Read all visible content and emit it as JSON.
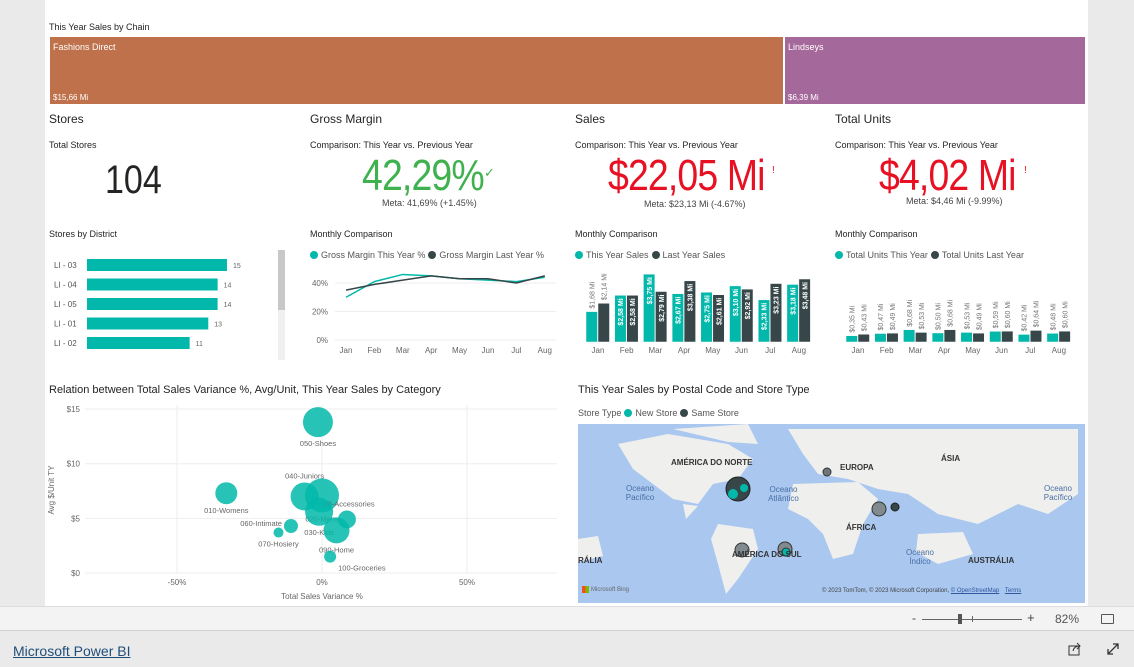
{
  "treemap": {
    "title": "This Year Sales by Chain",
    "items": [
      {
        "label": "Fashions Direct",
        "value": "$15,66 Mi",
        "color": "#be714b"
      },
      {
        "label": "Lindseys",
        "value": "$6,39 Mi",
        "color": "#a5689a"
      }
    ]
  },
  "kpis": {
    "stores": {
      "title": "Stores",
      "subtitle": "Total Stores",
      "value": "104"
    },
    "gross_margin": {
      "title": "Gross Margin",
      "subtitle": "Comparison: This Year vs. Previous Year",
      "value": "42,29%",
      "status_icon": "check-icon",
      "goal": "Meta: 41,69% (+1.45%)",
      "color": "#3fb14e"
    },
    "sales": {
      "title": "Sales",
      "subtitle": "Comparison: This Year vs. Previous Year",
      "value": "$22,05 Mi",
      "status_icon": "!",
      "goal": "Meta: $23,13 Mi (-4.67%)",
      "color": "#e81123"
    },
    "units": {
      "title": "Total Units",
      "subtitle": "Comparison: This Year vs. Previous Year",
      "value": "$4,02 Mi",
      "status_icon": "!",
      "goal": "Meta: $4,46 Mi (-9.99%)",
      "color": "#e81123"
    }
  },
  "colors": {
    "teal": "#01b8aa",
    "dark": "#374649"
  },
  "chart_data": [
    {
      "type": "bar",
      "orientation": "horizontal",
      "title": "Stores by District",
      "categories": [
        "LI - 03",
        "LI - 04",
        "LI - 05",
        "LI - 01",
        "LI - 02"
      ],
      "values": [
        15,
        14,
        14,
        13,
        11
      ]
    },
    {
      "type": "line",
      "title": "Monthly Comparison",
      "categories": [
        "Jan",
        "Feb",
        "Mar",
        "Apr",
        "May",
        "Jun",
        "Jul",
        "Aug"
      ],
      "yticks": [
        "0%",
        "20%",
        "40%"
      ],
      "ylim": [
        0,
        55
      ],
      "series": [
        {
          "name": "Gross Margin This Year %",
          "values": [
            30,
            41,
            46,
            45,
            43,
            42,
            41,
            44
          ]
        },
        {
          "name": "Gross Margin Last Year %",
          "values": [
            35,
            39,
            42,
            45,
            43,
            43,
            40,
            45
          ]
        }
      ]
    },
    {
      "type": "bar",
      "title": "Monthly Comparison",
      "categories": [
        "Jan",
        "Feb",
        "Mar",
        "Apr",
        "May",
        "Jun",
        "Jul",
        "Aug"
      ],
      "ylim": [
        0,
        4
      ],
      "series": [
        {
          "name": "This Year Sales",
          "values": [
            1.68,
            2.58,
            3.75,
            2.67,
            2.75,
            3.1,
            2.33,
            3.18
          ],
          "labels": [
            "$1,68 Mi",
            "$2,58 Mi",
            "$3,75 Mi",
            "$2,67 Mi",
            "$2,75 Mi",
            "$3,10 Mi",
            "$2,33 Mi",
            "$3,18 Mi"
          ]
        },
        {
          "name": "Last Year Sales",
          "values": [
            2.14,
            2.58,
            2.79,
            3.38,
            2.61,
            2.92,
            3.23,
            3.48
          ],
          "labels": [
            "$2,14 Mi",
            "$2,58 Mi",
            "$2,79 Mi",
            "$3,38 Mi",
            "$2,61 Mi",
            "$2,92 Mi",
            "$3,23 Mi",
            "$3,48 Mi"
          ]
        }
      ]
    },
    {
      "type": "bar",
      "title": "Monthly Comparison",
      "categories": [
        "Jan",
        "Feb",
        "Mar",
        "Apr",
        "May",
        "Jun",
        "Jul",
        "Aug"
      ],
      "ylim": [
        0,
        4
      ],
      "series": [
        {
          "name": "Total Units This Year",
          "values": [
            0.35,
            0.47,
            0.68,
            0.5,
            0.53,
            0.59,
            0.42,
            0.48
          ],
          "labels": [
            "$0,35 Mi",
            "$0,47 Mi",
            "$0,68 Mi",
            "$0,50 Mi",
            "$0,53 Mi",
            "$0,59 Mi",
            "$0,42 Mi",
            "$0,48 Mi"
          ]
        },
        {
          "name": "Total Units Last Year",
          "values": [
            0.43,
            0.49,
            0.53,
            0.68,
            0.49,
            0.6,
            0.64,
            0.6
          ],
          "labels": [
            "$0,43 Mi",
            "$0,49 Mi",
            "$0,53 Mi",
            "$0,68 Mi",
            "$0,49 Mi",
            "$0,60 Mi",
            "$0,64 Mi",
            "$0,60 Mi"
          ]
        }
      ]
    },
    {
      "type": "scatter",
      "title": "Relation between Total Sales Variance %, Avg/Unit, This Year Sales by Category",
      "xlabel": "Total Sales Variance %",
      "ylabel": "Avg $/Unit TY",
      "xticks": [
        "-50%",
        "0%",
        "50%"
      ],
      "yticks": [
        "$0",
        "$5",
        "$10",
        "$15"
      ],
      "xlim": [
        -82,
        81
      ],
      "ylim": [
        0,
        15
      ],
      "points": [
        {
          "label": "050-Shoes",
          "x": -1.4,
          "y": 13.8,
          "size": 15
        },
        {
          "label": "010-Womens",
          "x": -33,
          "y": 7.3,
          "size": 11
        },
        {
          "label": "040-Juniors",
          "x": -6,
          "y": 7.0,
          "size": 14
        },
        {
          "label": "020-Mens",
          "x": 0,
          "y": 7.1,
          "size": 17
        },
        {
          "label": "080-Accessories",
          "x": 8.6,
          "y": 4.9,
          "size": 9
        },
        {
          "label": "030-Kids",
          "x": -1,
          "y": 5.6,
          "size": 14
        },
        {
          "label": "060-Intimate",
          "x": -10.7,
          "y": 4.3,
          "size": 7
        },
        {
          "label": "070-Hosiery",
          "x": -15,
          "y": 3.7,
          "size": 5
        },
        {
          "label": "090-Home",
          "x": 5,
          "y": 3.9,
          "size": 13
        },
        {
          "label": "100-Groceries",
          "x": 2.8,
          "y": 1.5,
          "size": 6
        }
      ]
    }
  ],
  "map": {
    "title": "This Year Sales by Postal Code and Store Type",
    "legend_title": "Store Type",
    "legend": [
      {
        "name": "New Store",
        "color": "#01b8aa"
      },
      {
        "name": "Same Store",
        "color": "#374649"
      }
    ],
    "labels": {
      "na": "AMÉRICA DO NORTE",
      "eu": "EUROPA",
      "asia": "ÁSIA",
      "africa": "ÁFRICA",
      "sa": "AMÉRICA DO SUL",
      "aus": "AUSTRÁLIA",
      "aus_left": "RÁLIA",
      "pac1": "Oceano Pacífico",
      "pac2": "Oceano Pacífico",
      "atl": "Oceano Atlântico",
      "ind": "Oceano Índico"
    },
    "bing": "Microsoft Bing",
    "copyright": "© 2023 TomTom, © 2023 Microsoft Corporation,",
    "osm": "© OpenStreetMap",
    "terms": "Terms"
  },
  "zoom": {
    "minus": "-",
    "plus": "+",
    "level": "82%",
    "value": 82
  },
  "footer": {
    "brand": "Microsoft Power BI"
  }
}
